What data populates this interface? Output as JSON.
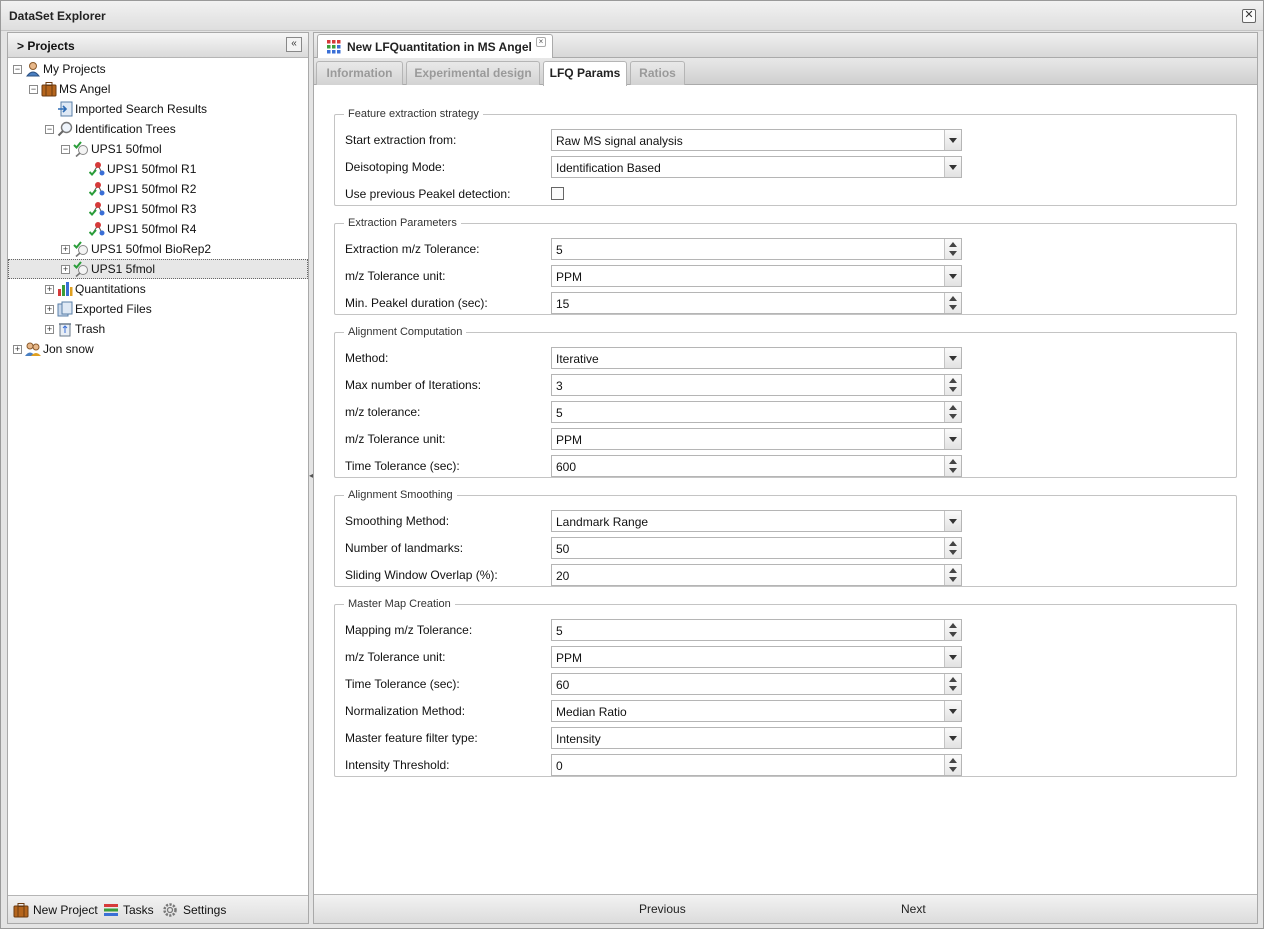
{
  "window": {
    "title": "DataSet Explorer",
    "close_label": "✕"
  },
  "left_panel": {
    "title": "> Projects",
    "collapse_label": "«",
    "tree": [
      {
        "label": "My Projects",
        "icon": "user-icon",
        "exp": "−"
      },
      {
        "label": "MS Angel",
        "icon": "briefcase-icon",
        "exp": "−"
      },
      {
        "label": "Imported Search Results",
        "icon": "import-icon",
        "exp": ""
      },
      {
        "label": "Identification Trees",
        "icon": "magnifier-icon",
        "exp": "−"
      },
      {
        "label": "UPS1 50fmol",
        "icon": "dataset-validated-icon",
        "exp": "−"
      },
      {
        "label": "UPS1 50fmol R1",
        "icon": "molecule-icon",
        "exp": ""
      },
      {
        "label": "UPS1 50fmol R2",
        "icon": "molecule-icon",
        "exp": ""
      },
      {
        "label": "UPS1 50fmol R3",
        "icon": "molecule-icon",
        "exp": ""
      },
      {
        "label": "UPS1 50fmol R4",
        "icon": "molecule-icon",
        "exp": ""
      },
      {
        "label": "UPS1 50fmol BioRep2",
        "icon": "dataset-validated-icon",
        "exp": "+"
      },
      {
        "label": "UPS1 5fmol",
        "icon": "dataset-validated-icon",
        "exp": "+"
      },
      {
        "label": "Quantitations",
        "icon": "bar-chart-icon",
        "exp": "+"
      },
      {
        "label": "Exported Files",
        "icon": "files-icon",
        "exp": "+"
      },
      {
        "label": "Trash",
        "icon": "trash-icon",
        "exp": "+"
      },
      {
        "label": "Jon snow",
        "icon": "user-icon",
        "exp": "+"
      }
    ],
    "footer": {
      "new_project": "New Project",
      "tasks": "Tasks",
      "settings": "Settings"
    }
  },
  "right_panel": {
    "doc_tab": "New LFQuantitation in MS Angel",
    "doc_tab_close": "×",
    "tabs": [
      "Information",
      "Experimental design",
      "LFQ Params",
      "Ratios"
    ],
    "active_tab": "LFQ Params",
    "sections": {
      "feature": {
        "legend": "Feature extraction strategy",
        "start_label": "Start extraction from:",
        "start_value": "Raw MS signal analysis",
        "deiso_label": "Deisotoping Mode:",
        "deiso_value": "Identification Based",
        "peakel_label": "Use previous Peakel detection:",
        "peakel_checked": false
      },
      "extraction": {
        "legend": "Extraction Parameters",
        "tol_label": "Extraction m/z Tolerance:",
        "tol_value": "5",
        "unit_label": "m/z Tolerance unit:",
        "unit_value": "PPM",
        "duration_label": "Min. Peakel duration (sec):",
        "duration_value": "15"
      },
      "alignment": {
        "legend": "Alignment Computation",
        "method_label": "Method:",
        "method_value": "Iterative",
        "iter_label": "Max number of Iterations:",
        "iter_value": "3",
        "tol_label": "m/z tolerance:",
        "tol_value": "5",
        "unit_label": "m/z Tolerance unit:",
        "unit_value": "PPM",
        "time_label": "Time Tolerance (sec):",
        "time_value": "600"
      },
      "smoothing": {
        "legend": "Alignment Smoothing",
        "method_label": "Smoothing Method:",
        "method_value": "Landmark Range",
        "landmarks_label": "Number of landmarks:",
        "landmarks_value": "50",
        "overlap_label": "Sliding Window Overlap (%):",
        "overlap_value": "20"
      },
      "master": {
        "legend": "Master Map Creation",
        "tol_label": "Mapping m/z Tolerance:",
        "tol_value": "5",
        "unit_label": "m/z Tolerance unit:",
        "unit_value": "PPM",
        "time_label": "Time Tolerance (sec):",
        "time_value": "60",
        "norm_label": "Normalization Method:",
        "norm_value": "Median Ratio",
        "filter_label": "Master feature filter type:",
        "filter_value": "Intensity",
        "threshold_label": "Intensity Threshold:",
        "threshold_value": "0"
      }
    },
    "nav": {
      "previous": "Previous",
      "next": "Next"
    }
  }
}
